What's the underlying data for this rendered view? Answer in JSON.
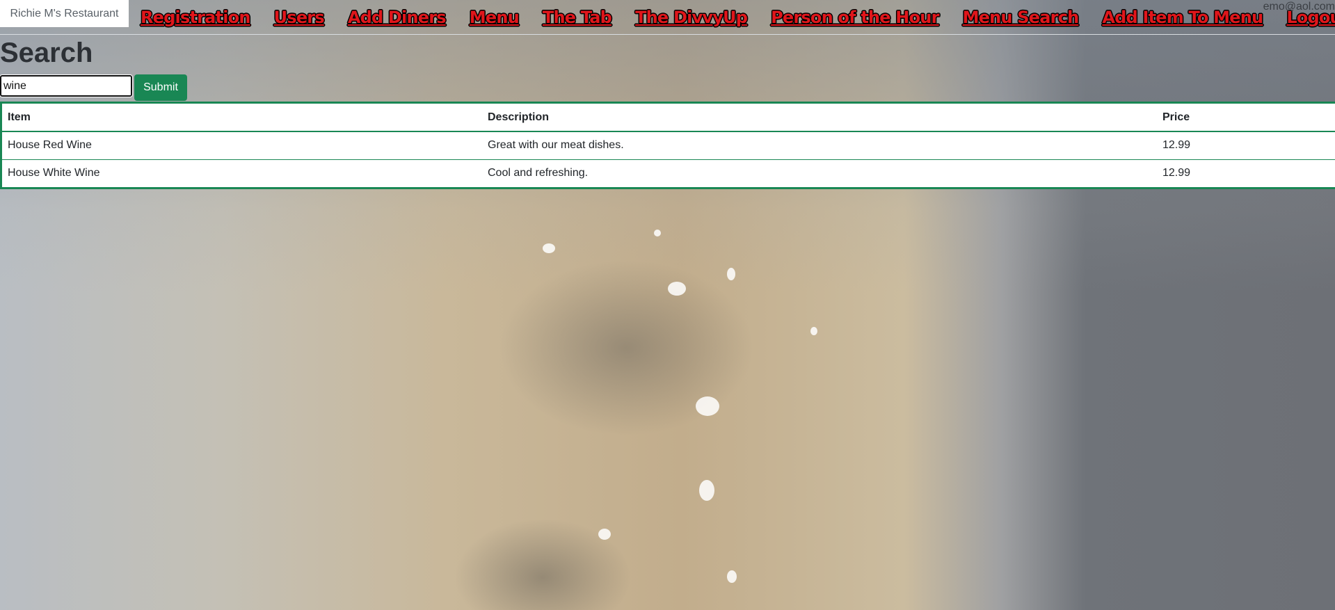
{
  "brand": "Richie M's Restaurant",
  "nav": [
    {
      "label": "Registration"
    },
    {
      "label": "Users"
    },
    {
      "label": "Add Diners"
    },
    {
      "label": "Menu"
    },
    {
      "label": "The Tab"
    },
    {
      "label": "The DivvyUp"
    },
    {
      "label": "Person of the Hour"
    },
    {
      "label": "Menu Search"
    },
    {
      "label": "Add Item To Menu"
    },
    {
      "label": "Logout"
    }
  ],
  "user_email": "emo@aol.com",
  "page_title": "Search",
  "search": {
    "value": "wine",
    "submit_label": "Submit"
  },
  "table": {
    "headers": [
      "Item",
      "Description",
      "Price"
    ],
    "rows": [
      [
        "House Red Wine",
        "Great with our meat dishes.",
        "12.99"
      ],
      [
        "House White Wine",
        "Cool and refreshing.",
        "12.99"
      ]
    ]
  },
  "colors": {
    "nav_link": "#e0161b",
    "accent_green": "#198754"
  }
}
